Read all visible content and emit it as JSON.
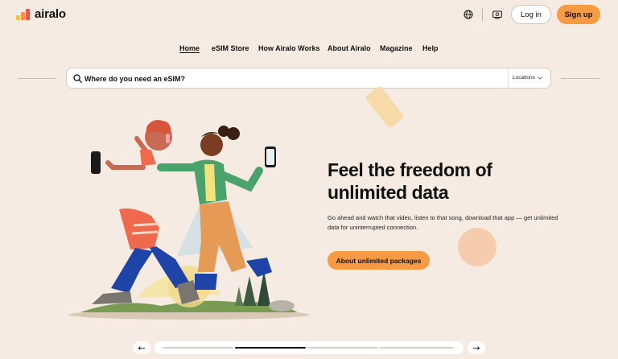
{
  "header": {
    "logo_text": "airalo",
    "icons": [
      "globe-icon",
      "currency-icon"
    ],
    "login_label": "Log in",
    "signup_label": "Sign up"
  },
  "nav": {
    "items": [
      "Home",
      "eSIM Store",
      "How Airalo Works",
      "About Airalo",
      "Magazine",
      "Help"
    ],
    "active": "Home"
  },
  "search": {
    "placeholder": "Where do you need an eSIM?",
    "locations_label": "Locations"
  },
  "hero": {
    "title": "Feel the freedom of unlimited data",
    "subtitle": "Go ahead and watch that video, listen to that song, download that app — get unlimited data for uninterrupted connection.",
    "cta_label": "About unlimited packages"
  },
  "carousel": {
    "prev_arrow": "←",
    "next_arrow": "→",
    "slide_count": 4,
    "active_index": 1
  },
  "colors": {
    "background": "#f5ebe2",
    "accent": "#f79a44",
    "logo_gradient": [
      "#f4a14a",
      "#e9594a"
    ]
  }
}
